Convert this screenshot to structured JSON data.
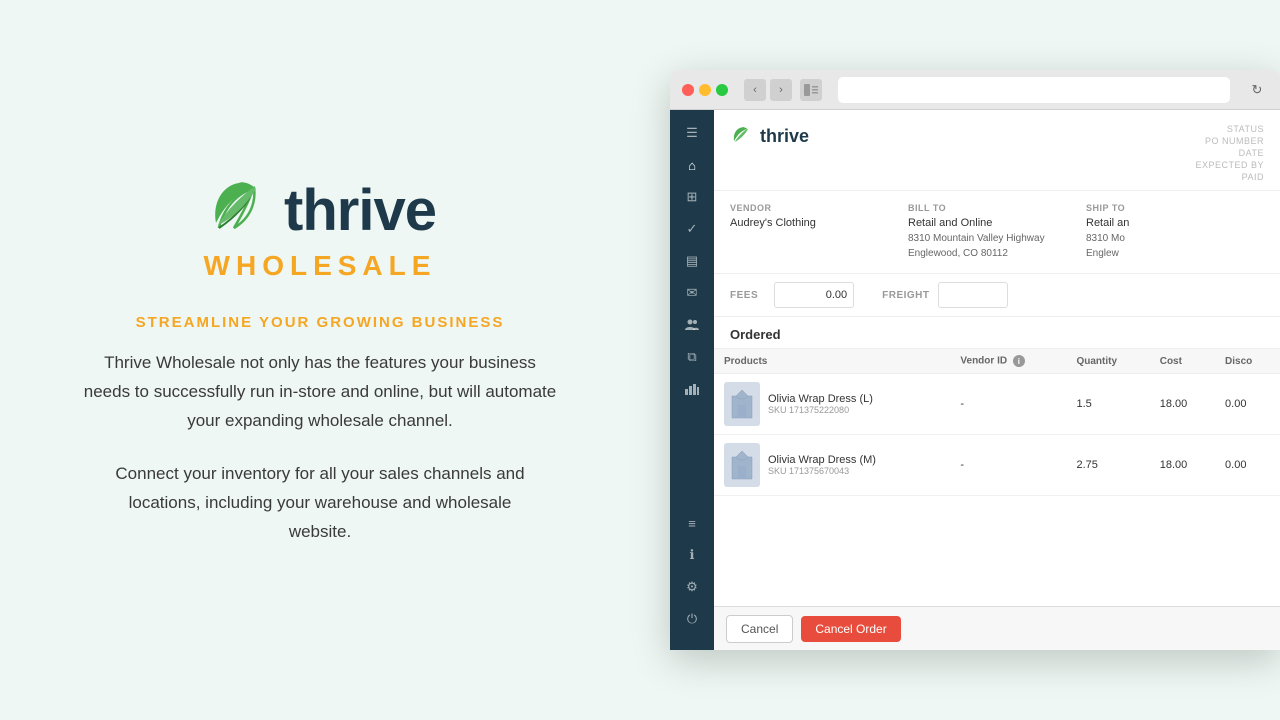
{
  "page": {
    "background_color": "#eef7f3"
  },
  "left_panel": {
    "logo": {
      "thrive": "thrive",
      "wholesale": "WHOLESALE"
    },
    "tagline": "STREAMLINE YOUR GROWING BUSINESS",
    "description1": "Thrive Wholesale not only has the features your business needs to successfully run in-store and online, but will automate your expanding wholesale channel.",
    "description2": "Connect your inventory for all your sales channels and locations, including your warehouse and wholesale website."
  },
  "browser": {
    "address_bar": "",
    "app": {
      "logo": "thrive",
      "po_meta": {
        "status_label": "STATUS",
        "po_number_label": "PO NUMBER",
        "date_label": "DATE",
        "expected_by_label": "EXPECTED BY",
        "paid_label": "PAID"
      },
      "vendor_section": {
        "vendor_label": "VENDOR",
        "vendor_name": "Audrey's Clothing",
        "bill_to_label": "BILL TO",
        "bill_to_name": "Retail and Online",
        "bill_to_address1": "8310 Mountain Valley Highway",
        "bill_to_address2": "Englewood, CO 80112",
        "ship_to_label": "SHIP TO",
        "ship_to_name": "Retail an",
        "ship_to_address1": "8310 Mo",
        "ship_to_address2": "Englew"
      },
      "fees": {
        "fees_label": "FEES",
        "fees_value": "0.00",
        "freight_label": "FREIGHT",
        "freight_value": ""
      },
      "ordered": {
        "title": "Ordered",
        "table": {
          "headers": [
            "Products",
            "Vendor ID",
            "Quantity",
            "Cost",
            "Disco"
          ],
          "rows": [
            {
              "product_name": "Olivia Wrap Dress (L)",
              "product_sku": "SKU 171375222080",
              "vendor_id": "-",
              "quantity": "1.5",
              "cost": "18.00",
              "discount": "0.00"
            },
            {
              "product_name": "Olivia Wrap Dress (M)",
              "product_sku": "SKU 171375670043",
              "vendor_id": "-",
              "quantity": "2.75",
              "cost": "18.00",
              "discount": "0.00"
            }
          ]
        }
      },
      "footer": {
        "cancel_label": "Cancel",
        "cancel_order_label": "Cancel Order"
      }
    }
  },
  "sidebar_icons": {
    "menu": "☰",
    "home": "⌂",
    "grid": "⊞",
    "check": "✓",
    "document": "▤",
    "mail": "✉",
    "users": "👤",
    "copy": "⧉",
    "chart": "📊",
    "list_bottom": "≡",
    "info": "ℹ",
    "settings": "⚙",
    "power": "⏻"
  }
}
